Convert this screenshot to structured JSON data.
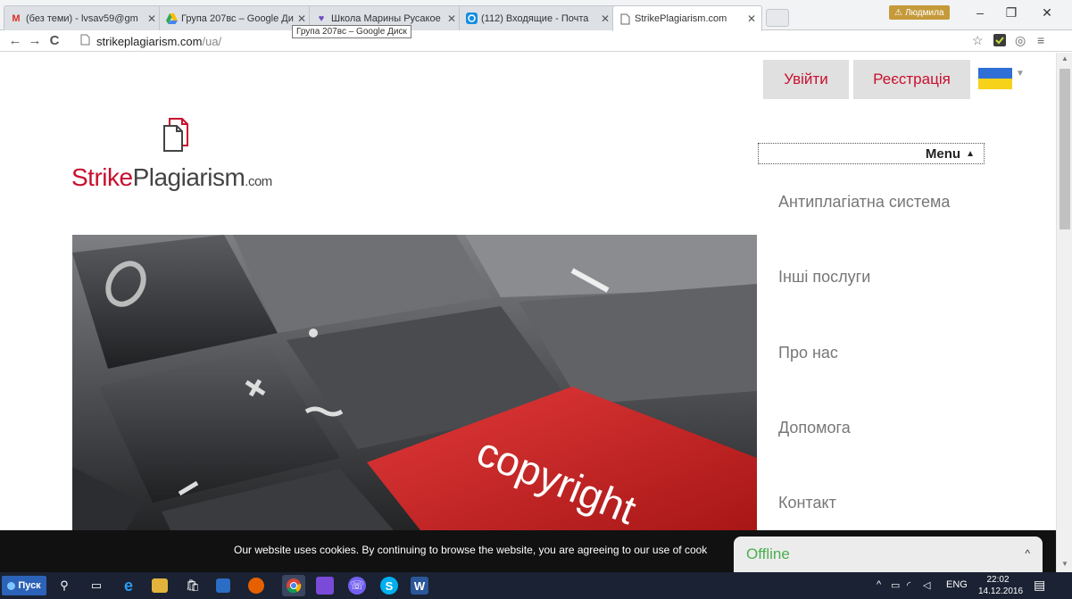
{
  "browser": {
    "tabs": [
      {
        "icon": "gmail-icon",
        "title": "(без теми) - lvsav59@gm"
      },
      {
        "icon": "google-drive-icon",
        "title": "Група 207вс – Google Ди"
      },
      {
        "icon": "site-icon",
        "title": "Школа Марины Русакое"
      },
      {
        "icon": "mail-icon",
        "title": "(112) Входящие - Почта"
      },
      {
        "icon": "page-icon",
        "title": "StrikePlagiarism.com"
      }
    ],
    "tooltip": "Група 207вс – Google Диск",
    "profile_name": "Людмила",
    "url_host": "strikeplagiarism.com",
    "url_path": "/ua/"
  },
  "header": {
    "login": "Увійти",
    "register": "Реєстрація"
  },
  "logo": {
    "strike": "Strike",
    "plagiarism": "Plagiarism",
    "com": ".com"
  },
  "menu": {
    "toggle_label": "Menu",
    "items": [
      "Антиплагіатна система",
      "Інші послуги",
      "Про нас",
      "Допомога",
      "Контакт"
    ]
  },
  "hero": {
    "key_text": "copyright"
  },
  "cookie": {
    "text": "Our website uses cookies. By continuing to browse the website, you are agreeing to our use of cook"
  },
  "chat": {
    "status": "Offline"
  },
  "taskbar": {
    "start_label": "Пуск",
    "lang": "ENG",
    "time": "22:02",
    "date": "14.12.2016"
  },
  "colors": {
    "brand_red": "#c8102e",
    "online_green": "#4caf50"
  }
}
